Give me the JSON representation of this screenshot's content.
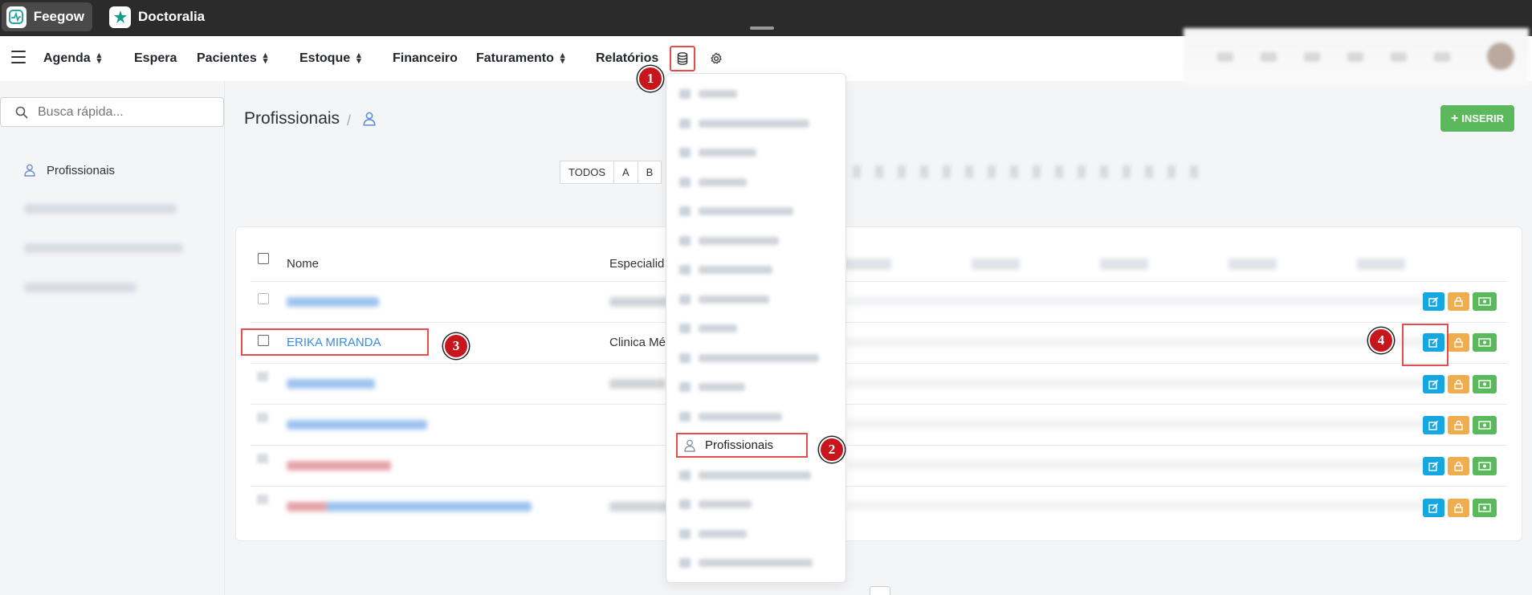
{
  "apps": [
    {
      "label": "Feegow"
    },
    {
      "label": "Doctoralia"
    }
  ],
  "nav": {
    "items": [
      "Agenda",
      "Espera",
      "Pacientes",
      "Estoque",
      "Financeiro",
      "Faturamento",
      "Relatórios"
    ]
  },
  "search": {
    "placeholder": "Busca rápida..."
  },
  "sidebar": {
    "active_item": "Profissionais"
  },
  "page": {
    "title": "Profissionais",
    "insert_label": "INSERIR",
    "separator": "/"
  },
  "alphabet": [
    "TODOS",
    "A",
    "B"
  ],
  "table": {
    "headers": {
      "name": "Nome",
      "specialty": "Especialid"
    },
    "highlighted_row": {
      "name": "ERIKA MIRANDA",
      "specialty": "Clinica Mé"
    }
  },
  "dropdown": {
    "active_item": "Profissionais"
  },
  "annotations": [
    "1",
    "2",
    "3",
    "4"
  ],
  "colors": {
    "accent": "#3a8dde",
    "highlight": "#e64c4c",
    "insert": "#5cb85c",
    "edit": "#17a7e0",
    "lock": "#f0ad4e",
    "money": "#5cb85c",
    "badge": "#c8161d"
  },
  "icons": {
    "db": "database-icon",
    "gear": "gear-icon",
    "search": "search-icon",
    "user": "user-icon",
    "edit": "edit-icon",
    "lock": "lock-icon",
    "money": "money-icon",
    "menu": "menu-icon"
  }
}
